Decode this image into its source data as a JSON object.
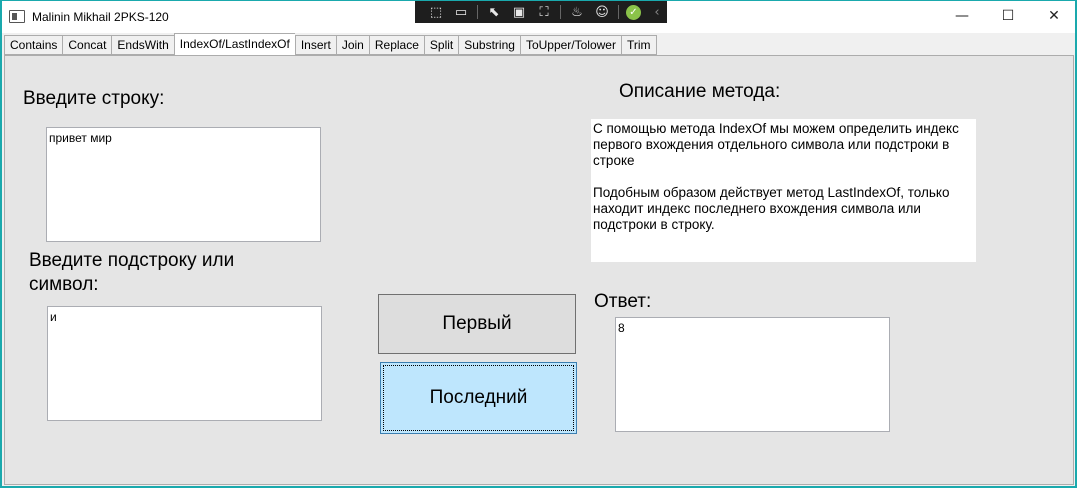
{
  "window": {
    "title": "Malinin Mikhail 2PKS-120",
    "controls": {
      "minimize": "—",
      "maximize": "☐",
      "close": "✕"
    }
  },
  "debug_toolbar": {
    "icons": [
      "select-element-icon",
      "video-icon",
      "pointer-icon",
      "frame-icon",
      "track-focus-icon",
      "hot-reload-icon",
      "accessibility-icon",
      "check-icon",
      "collapse-icon"
    ]
  },
  "tabs": [
    {
      "label": "Contains",
      "active": false
    },
    {
      "label": "Concat",
      "active": false
    },
    {
      "label": "EndsWith",
      "active": false
    },
    {
      "label": "IndexOf/LastIndexOf",
      "active": true
    },
    {
      "label": "Insert",
      "active": false
    },
    {
      "label": "Join",
      "active": false
    },
    {
      "label": "Replace",
      "active": false
    },
    {
      "label": "Split",
      "active": false
    },
    {
      "label": "Substring",
      "active": false
    },
    {
      "label": "ToUpper/Tolower",
      "active": false
    },
    {
      "label": "Trim",
      "active": false
    }
  ],
  "form": {
    "string_label": "Введите строку:",
    "string_value": "привет мир",
    "substring_label_line1": "Введите подстроку или",
    "substring_label_line2": "символ:",
    "substring_value": "и",
    "description_label": "Описание метода:",
    "description_p1": "С помощью метода IndexOf мы можем определить индекс первого вхождения отдельного символа или подстроки в строке",
    "description_p2": "Подобным образом действует метод LastIndexOf, только находит индекс последнего вхождения символа или подстроки в строку.",
    "answer_label": "Ответ:",
    "answer_value": "8",
    "first_button": "Первый",
    "last_button": "Последний"
  }
}
